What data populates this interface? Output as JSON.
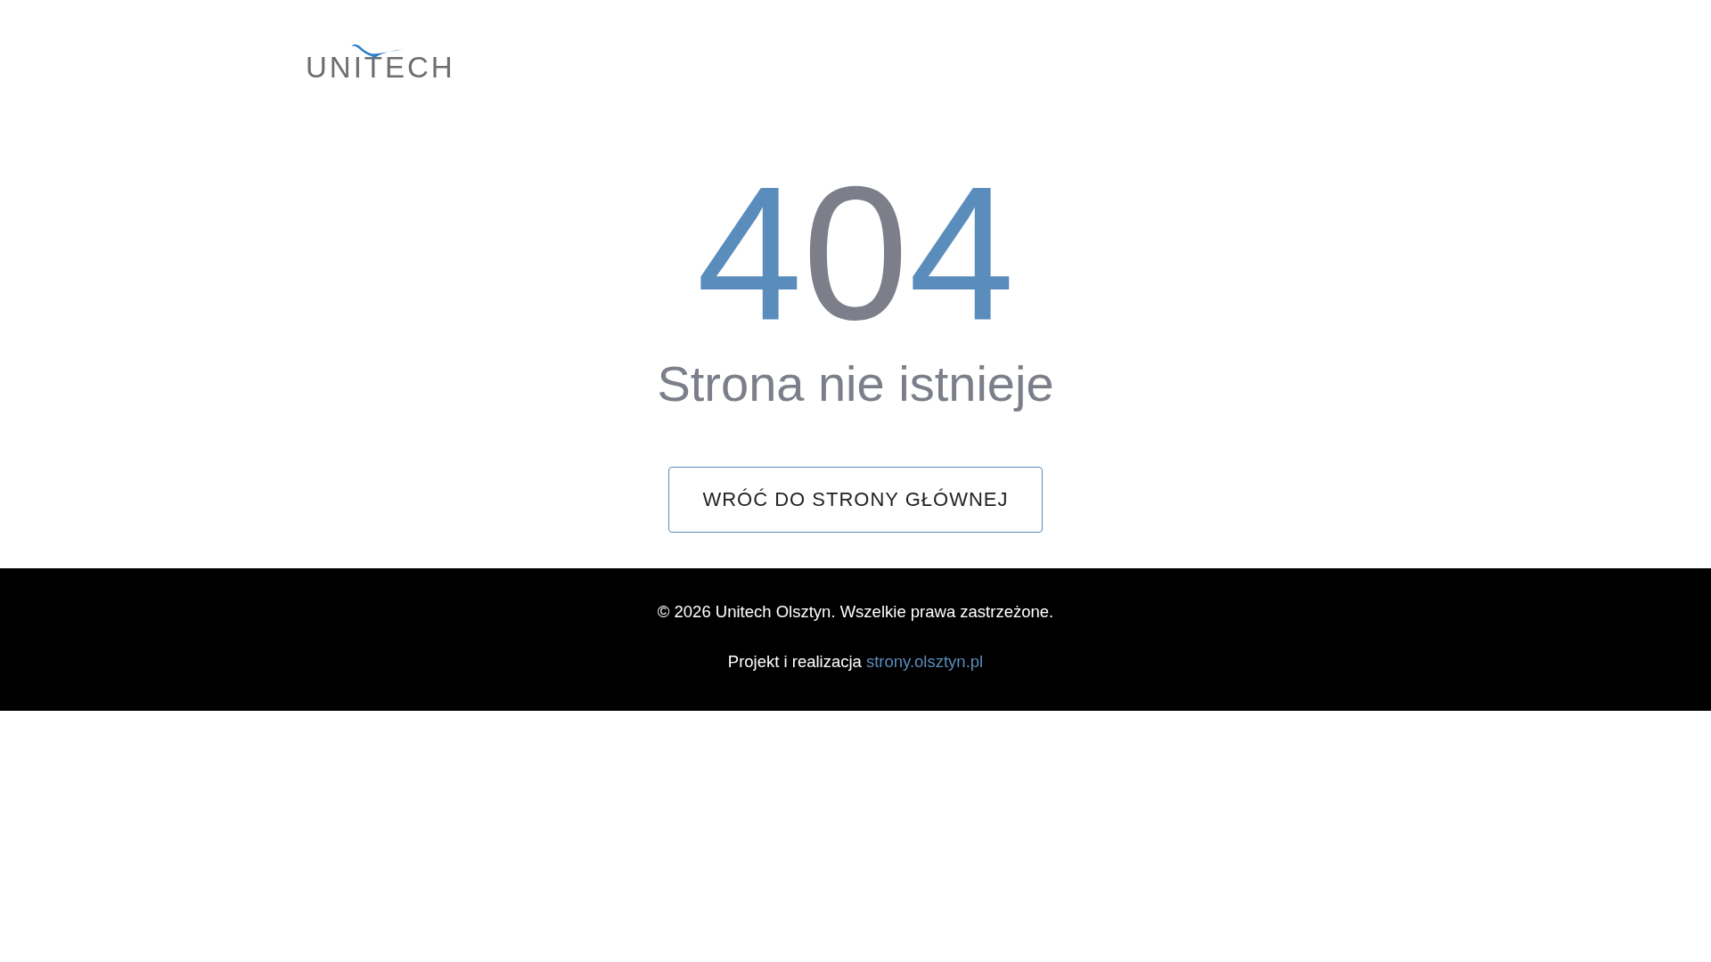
{
  "header": {
    "logo": "UNITECH"
  },
  "error": {
    "digits": [
      {
        "text": "4",
        "color": "#5a8cbc"
      },
      {
        "text": "0",
        "color": "#7c7f8a"
      },
      {
        "text": "4",
        "color": "#5a8cbc"
      }
    ],
    "message": "Strona nie istnieje"
  },
  "button": {
    "label": "WRÓĆ DO STRONY GŁÓWNEJ"
  },
  "footer": {
    "copyright": "© 2026 Unitech Olsztyn. Wszelkie prawa zastrzeżone.",
    "credit": "Projekt i realizacja",
    "link": "strony.olsztyn.pl"
  }
}
